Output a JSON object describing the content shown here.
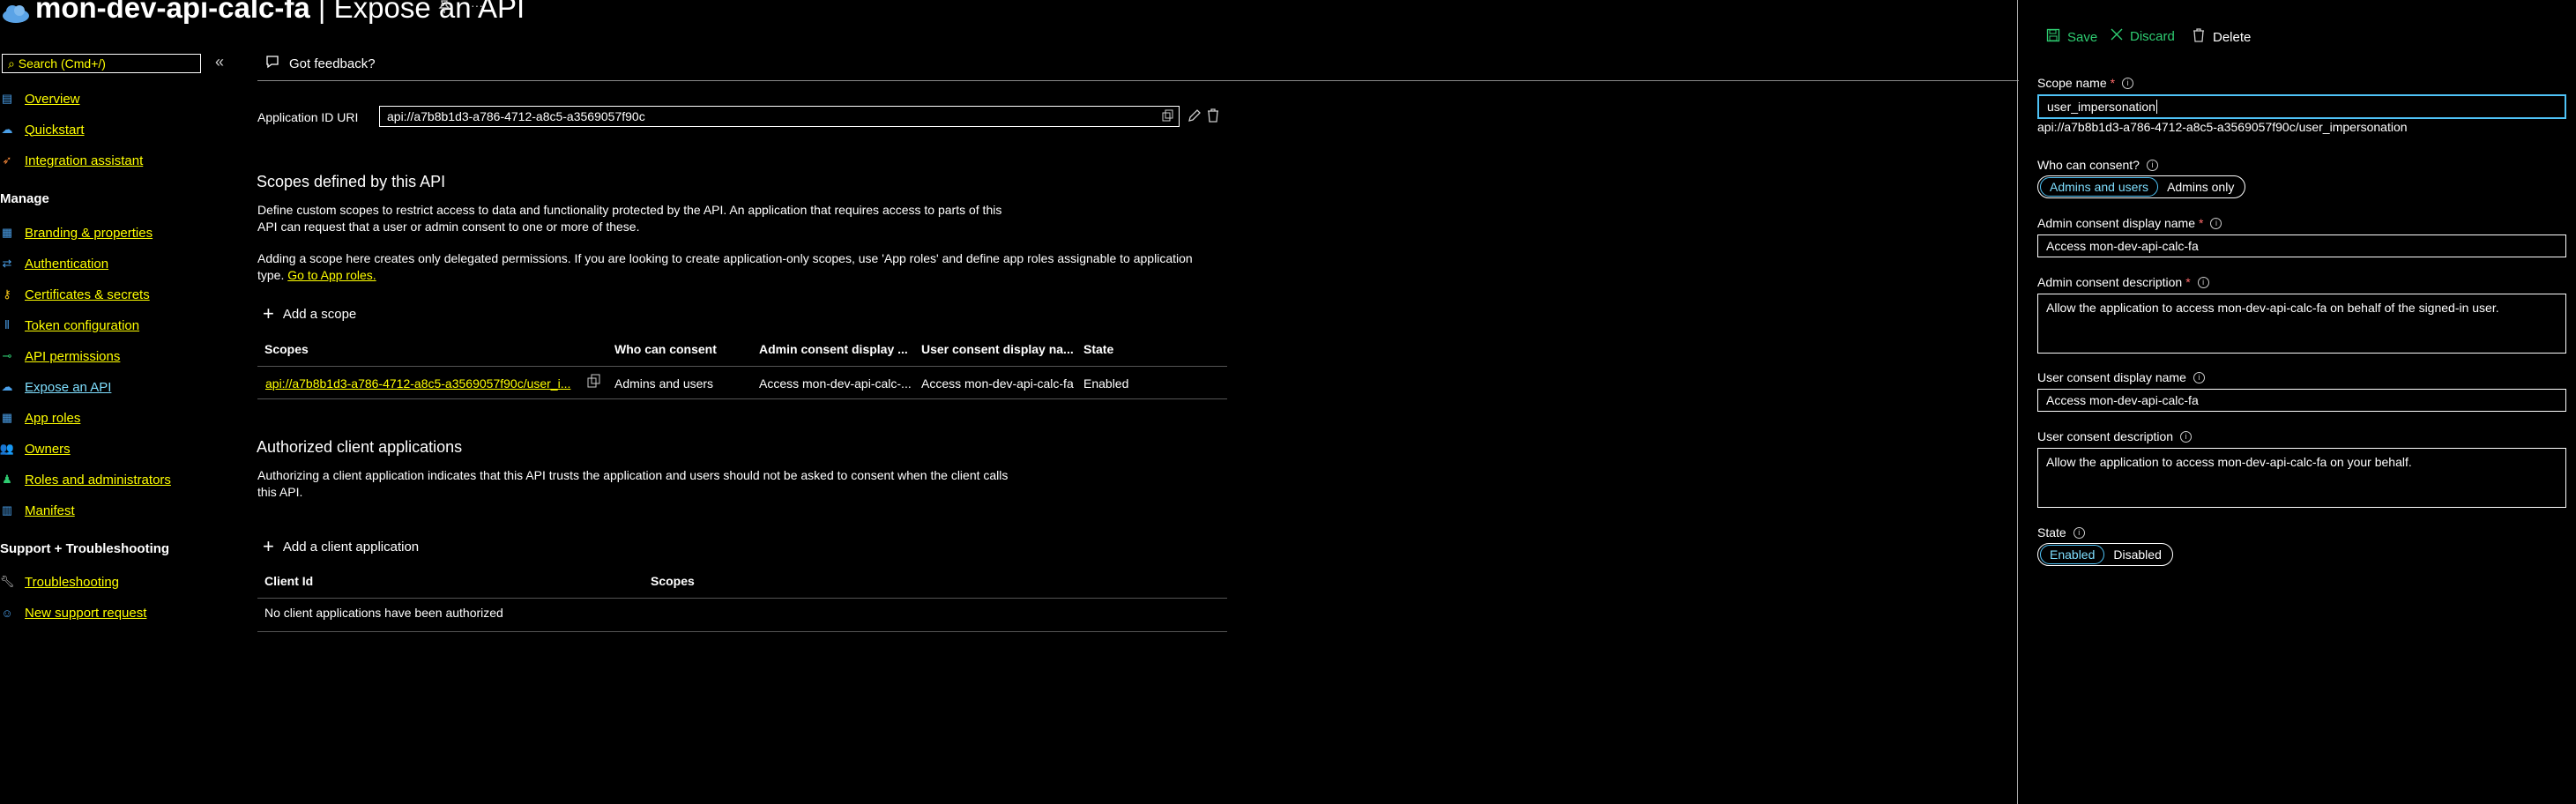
{
  "header": {
    "app_name": "mon-dev-api-calc-fa",
    "separator": " | ",
    "page": "Expose an API",
    "more": "···"
  },
  "sidebar": {
    "search_placeholder": "Search (Cmd+/)",
    "collapse": "«",
    "items": [
      {
        "label": "Overview",
        "icon": "overview-icon"
      },
      {
        "label": "Quickstart",
        "icon": "quickstart-icon"
      },
      {
        "label": "Integration assistant",
        "icon": "rocket-icon"
      }
    ],
    "manage_title": "Manage",
    "manage_items": [
      {
        "label": "Branding & properties"
      },
      {
        "label": "Authentication"
      },
      {
        "label": "Certificates & secrets"
      },
      {
        "label": "Token configuration"
      },
      {
        "label": "API permissions"
      },
      {
        "label": "Expose an API"
      },
      {
        "label": "App roles"
      },
      {
        "label": "Owners"
      },
      {
        "label": "Roles and administrators"
      },
      {
        "label": "Manifest"
      }
    ],
    "support_title": "Support + Troubleshooting",
    "support_items": [
      {
        "label": "Troubleshooting"
      },
      {
        "label": "New support request"
      }
    ]
  },
  "main": {
    "feedback": "Got feedback?",
    "app_id_uri_label": "Application ID URI",
    "app_id_uri": "api://a7b8b1d3-a786-4712-a8c5-a3569057f90c",
    "scopes_title": "Scopes defined by this API",
    "scopes_desc_1": "Define custom scopes to restrict access to data and functionality protected by the API. An application that requires access to parts of this",
    "scopes_desc_2": "API can request that a user or admin consent to one or more of these.",
    "scopes_desc_3": "Adding a scope here creates only delegated permissions. If you are looking to create application-only scopes, use 'App roles' and define app roles assignable to application",
    "scopes_desc_4": "type.",
    "go_to_app_roles": "Go to App roles.",
    "add_scope": "Add a scope",
    "scopes_table": {
      "headers": [
        "Scopes",
        "Who can consent",
        "Admin consent display ...",
        "User consent display na...",
        "State"
      ],
      "row": {
        "scope": "api://a7b8b1d3-a786-4712-a8c5-a3569057f90c/user_i...",
        "who": "Admins and users",
        "admin_display": "Access mon-dev-api-calc-...",
        "user_display": "Access mon-dev-api-calc-fa",
        "state": "Enabled"
      }
    },
    "clients_title": "Authorized client applications",
    "clients_desc_1": "Authorizing a client application indicates that this API trusts the application and users should not be asked to consent when the client calls",
    "clients_desc_2": "this API.",
    "add_client": "Add a client application",
    "clients_table": {
      "headers": [
        "Client Id",
        "Scopes"
      ],
      "empty": "No client applications have been authorized"
    }
  },
  "panel": {
    "save": "Save",
    "discard": "Discard",
    "delete": "Delete",
    "scope_name_label": "Scope name",
    "scope_name_value": "user_impersonation",
    "scope_full": "api://a7b8b1d3-a786-4712-a8c5-a3569057f90c/user_impersonation",
    "who_label": "Who can consent?",
    "who_options": [
      "Admins and users",
      "Admins only"
    ],
    "who_selected": "Admins and users",
    "admin_display_label": "Admin consent display name",
    "admin_display_value": "Access mon-dev-api-calc-fa",
    "admin_desc_label": "Admin consent description",
    "admin_desc_value": "Allow the application to access mon-dev-api-calc-fa on behalf of the signed-in user.",
    "user_display_label": "User consent display name",
    "user_display_value": "Access mon-dev-api-calc-fa",
    "user_desc_label": "User consent description",
    "user_desc_value": "Allow the application to access mon-dev-api-calc-fa on your behalf.",
    "state_label": "State",
    "state_options": [
      "Enabled",
      "Disabled"
    ],
    "state_selected": "Enabled",
    "required_mark": "*",
    "info_mark": "i"
  }
}
